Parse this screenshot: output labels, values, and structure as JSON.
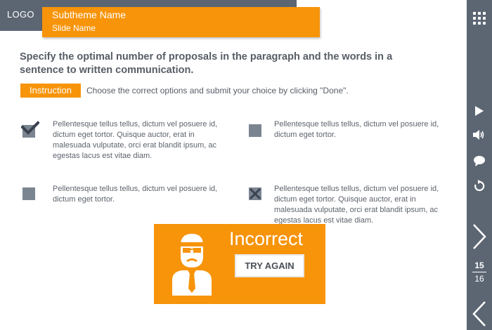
{
  "header": {
    "logo": "LOGO",
    "subtheme": "Subtheme Name",
    "slide_name": "Slide Name"
  },
  "question": "Specify the optimal number of proposals in the paragraph and the words in a sentence to written communication.",
  "instruction": {
    "label": "Instruction",
    "text": "Choose the correct options and submit your choice by clicking \"Done\"."
  },
  "options": [
    {
      "text": "Pellentesque tellus tellus, dictum vel posuere id, dictum eget tortor. Quisque auctor, erat in malesuada vulputate, orci erat blandit ipsum, ac egestas lacus est vitae diam.",
      "state": "correct"
    },
    {
      "text": "Pellentesque tellus tellus, dictum vel posuere id, dictum eget tortor.",
      "state": "unchecked"
    },
    {
      "text": "Pellentesque tellus tellus, dictum vel posuere id, dictum eget tortor.",
      "state": "unchecked"
    },
    {
      "text": "Pellentesque tellus tellus, dictum vel posuere id, dictum eget tortor. Quisque auctor, erat in malesuada vulputate, orci erat blandit ipsum, ac egestas lacus est vitae diam.",
      "state": "wrong"
    }
  ],
  "feedback": {
    "title": "Incorrect",
    "button": "TRY AGAIN"
  },
  "sidebar": {
    "icons": [
      "grid-menu-icon",
      "play-icon",
      "volume-icon",
      "comment-icon",
      "replay-icon",
      "next-arrow-icon",
      "prev-arrow-icon"
    ],
    "page_current": "15",
    "page_total": "16"
  },
  "colors": {
    "accent": "#f7940a",
    "dark": "#5c6673",
    "checkbox": "#7b8592",
    "text": "#575d66"
  }
}
